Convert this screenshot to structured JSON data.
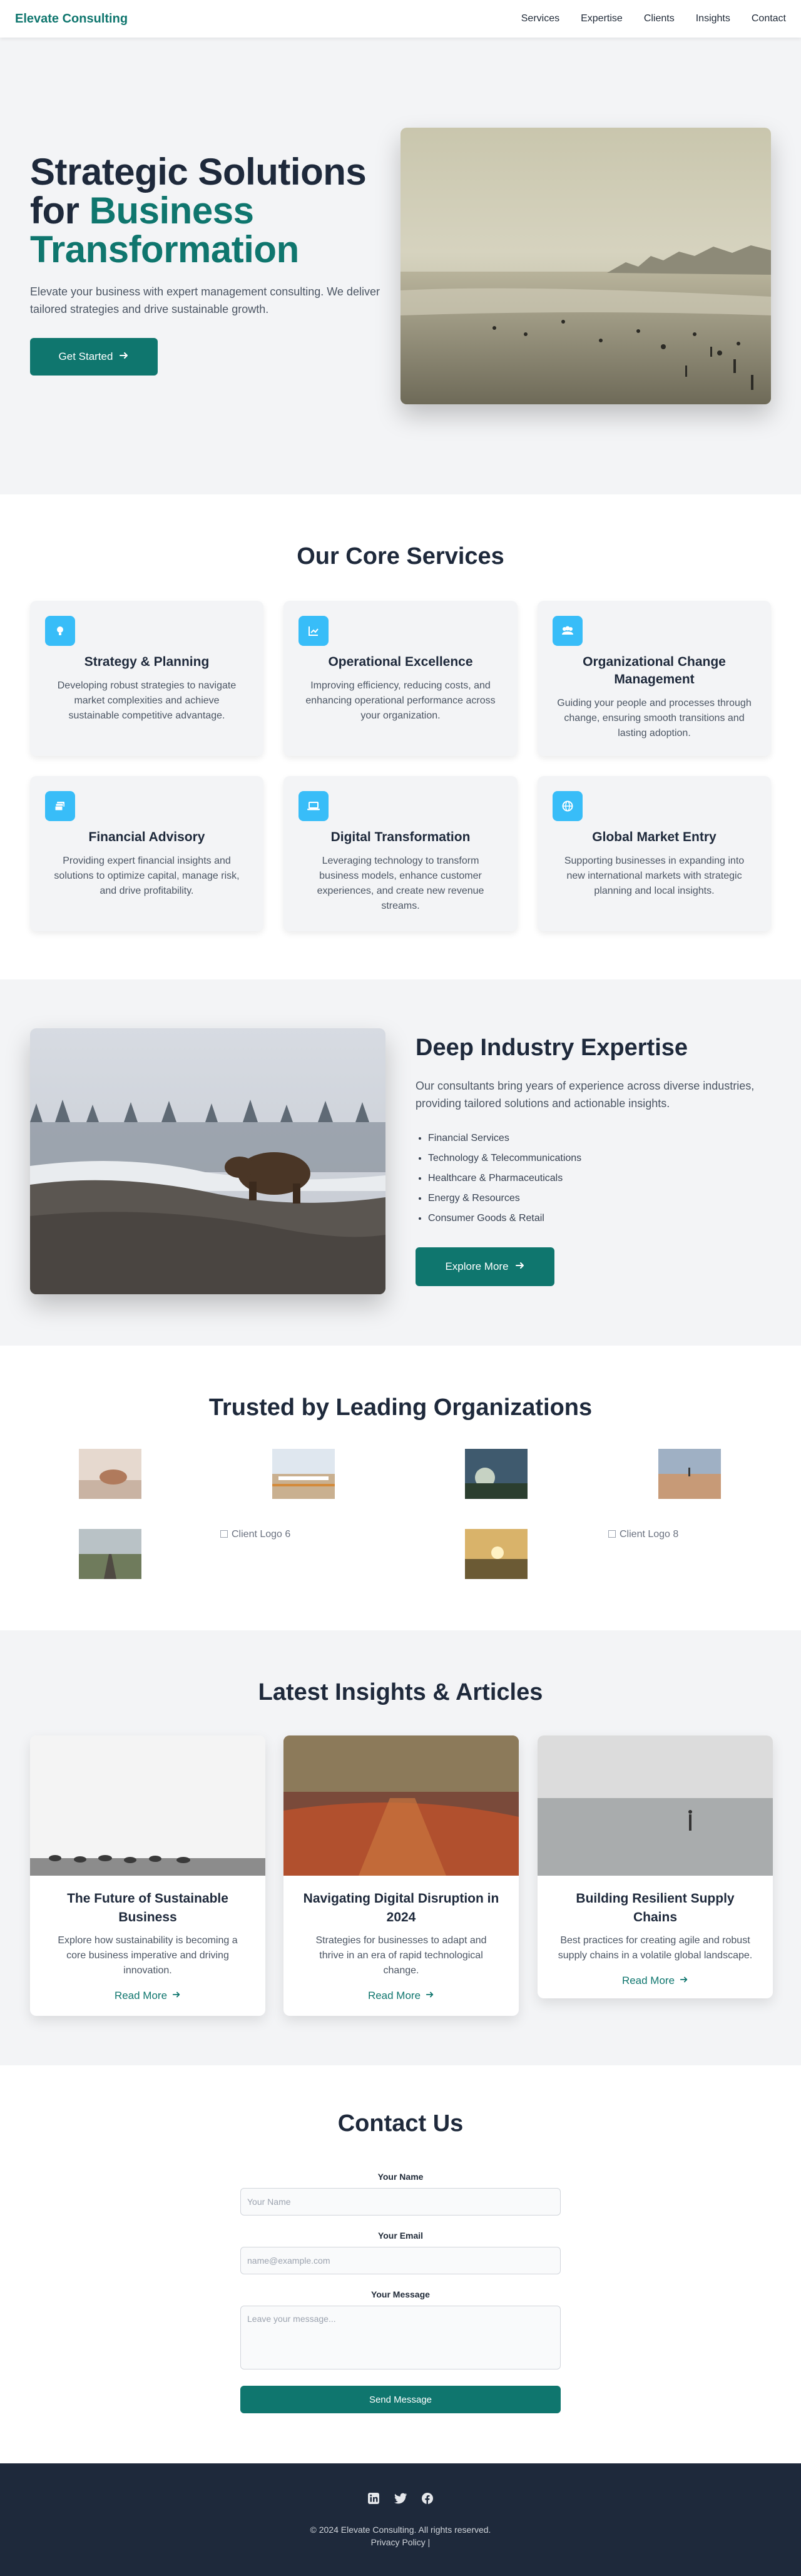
{
  "nav": {
    "brand": "Elevate Consulting",
    "links": [
      "Services",
      "Expertise",
      "Clients",
      "Insights",
      "Contact"
    ]
  },
  "hero": {
    "title_line1": "Strategic Solutions",
    "title_for": "for",
    "title_accent_1": "Business",
    "title_accent_2": "Transformation",
    "subtitle": "Elevate your business with expert management consulting. We deliver tailored strategies and drive sustainable growth.",
    "cta": "Get Started"
  },
  "services": {
    "title": "Our Core Services",
    "items": [
      {
        "title": "Strategy & Planning",
        "text": "Developing robust strategies to navigate market complexities and achieve sustainable competitive advantage.",
        "icon": "lightbulb-icon"
      },
      {
        "title": "Operational Excellence",
        "text": "Improving efficiency, reducing costs, and enhancing operational performance across your organization.",
        "icon": "chart-line-icon"
      },
      {
        "title": "Organizational Change Management",
        "text": "Guiding your people and processes through change, ensuring smooth transitions and lasting adoption.",
        "icon": "users-icon"
      },
      {
        "title": "Financial Advisory",
        "text": "Providing expert financial insights and solutions to optimize capital, manage risk, and drive profitability.",
        "icon": "money-icon"
      },
      {
        "title": "Digital Transformation",
        "text": "Leveraging technology to transform business models, enhance customer experiences, and create new revenue streams.",
        "icon": "laptop-icon"
      },
      {
        "title": "Global Market Entry",
        "text": "Supporting businesses in expanding into new international markets with strategic planning and local insights.",
        "icon": "globe-icon"
      }
    ]
  },
  "expertise": {
    "title": "Deep Industry Expertise",
    "subtitle": "Our consultants bring years of experience across diverse industries, providing tailored solutions and actionable insights.",
    "industries": [
      "Financial Services",
      "Technology & Telecommunications",
      "Healthcare & Pharmaceuticals",
      "Energy & Resources",
      "Consumer Goods & Retail"
    ],
    "cta": "Explore More"
  },
  "clients": {
    "title": "Trusted by Leading Organizations",
    "broken_logos": [
      "Client Logo 6",
      "Client Logo 8"
    ]
  },
  "insights": {
    "title": "Latest Insights & Articles",
    "articles": [
      {
        "title": "The Future of Sustainable Business",
        "text": "Explore how sustainability is becoming a core business imperative and driving innovation.",
        "link": "Read More"
      },
      {
        "title": "Navigating Digital Disruption in 2024",
        "text": "Strategies for businesses to adapt and thrive in an era of rapid technological change.",
        "link": "Read More"
      },
      {
        "title": "Building Resilient Supply Chains",
        "text": "Best practices for creating agile and robust supply chains in a volatile global landscape.",
        "link": "Read More"
      }
    ]
  },
  "contact": {
    "title": "Contact Us",
    "name_label": "Your Name",
    "name_placeholder": "Your Name",
    "email_label": "Your Email",
    "email_placeholder": "name@example.com",
    "message_label": "Your Message",
    "message_placeholder": "Leave your message...",
    "submit": "Send Message"
  },
  "footer": {
    "copyright": "© 2024 Elevate Consulting. All rights reserved.",
    "privacy": "Privacy Policy |"
  },
  "colors": {
    "accent": "#0f766e",
    "icon_bg": "#38bdf8",
    "footer_bg": "#1e293b",
    "section_bg": "#f3f4f6"
  }
}
